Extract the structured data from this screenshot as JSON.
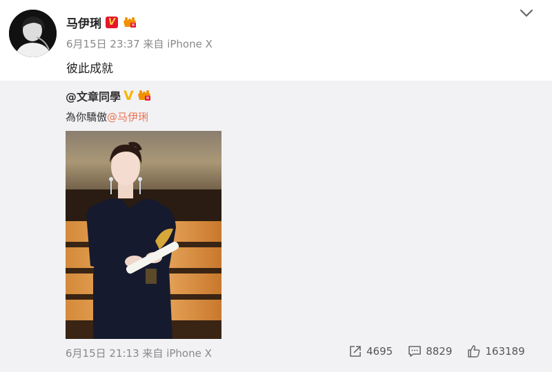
{
  "post": {
    "author": "马伊琍",
    "timestamp": "6月15日 23:37",
    "source": "来自 iPhone X",
    "text": "彼此成就",
    "menu_icon": "chevron-down-icon"
  },
  "repost": {
    "author": "@文章同學",
    "text_prefix": "為你驕傲",
    "mention": "@马伊琍",
    "timestamp": "6月15日 21:13",
    "source": "来自 iPhone X",
    "stats": {
      "forward": "4695",
      "comment": "8829",
      "like": "163189"
    }
  },
  "colors": {
    "mention": "#eb7350",
    "verified_red": "#e6162d",
    "verified_gold": "#f7b500",
    "repost_bg": "#f2f2f5"
  }
}
